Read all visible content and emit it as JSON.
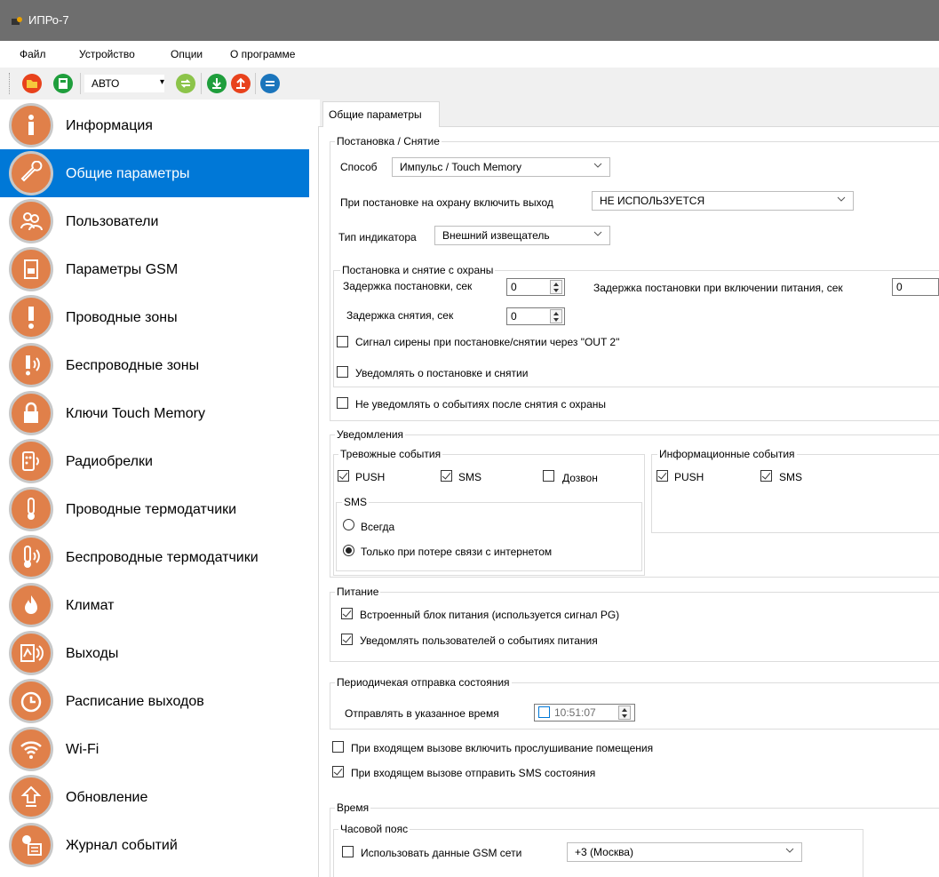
{
  "window": {
    "title": "ИПРо-7"
  },
  "menu": [
    "Файл",
    "Устройство",
    "Опции",
    "О программе"
  ],
  "toolbar": {
    "mode_value": "АВТО"
  },
  "sidebar": {
    "items": [
      {
        "label": "Информация",
        "icon": "info-icon"
      },
      {
        "label": "Общие параметры",
        "icon": "wrench-icon",
        "active": true
      },
      {
        "label": "Пользователи",
        "icon": "users-icon"
      },
      {
        "label": "Параметры GSM",
        "icon": "sim-card-icon"
      },
      {
        "label": "Проводные зоны",
        "icon": "exclamation-icon"
      },
      {
        "label": "Беспроводные зоны",
        "icon": "wireless-exclamation-icon"
      },
      {
        "label": "Ключи Touch Memory",
        "icon": "lock-icon"
      },
      {
        "label": "Радиобрелки",
        "icon": "keyfob-icon"
      },
      {
        "label": "Проводные термодатчики",
        "icon": "thermometer-icon"
      },
      {
        "label": "Беспроводные термодатчики",
        "icon": "wireless-thermometer-icon"
      },
      {
        "label": "Климат",
        "icon": "flame-icon"
      },
      {
        "label": "Выходы",
        "icon": "relay-icon"
      },
      {
        "label": "Расписание выходов",
        "icon": "clock-icon"
      },
      {
        "label": "Wi-Fi",
        "icon": "wifi-icon"
      },
      {
        "label": "Обновление",
        "icon": "upload-arrow-icon"
      },
      {
        "label": "Журнал событий",
        "icon": "log-icon"
      }
    ]
  },
  "main": {
    "tab": "Общие параметры",
    "arming": {
      "title": "Постановка / Снятие",
      "method_label": "Способ",
      "method_value": "Импульс / Touch Memory",
      "output_label": "При постановке на охрану включить выход",
      "output_value": "НЕ ИСПОЛЬЗУЕТСЯ",
      "indicator_label": "Тип индикатора",
      "indicator_value": "Внешний извещатель",
      "sub": {
        "title": "Постановка и снятие с охраны",
        "arm_delay_label": "Задержка постановки, сек",
        "arm_delay_value": "0",
        "power_delay_label": "Задержка постановки при включении питания, сек",
        "power_delay_value": "0",
        "disarm_delay_label": "Задержка снятия, сек",
        "disarm_delay_value": "0",
        "siren_label": "Сигнал сирены при постановке/снятии через \"OUT 2\"",
        "siren_checked": false,
        "notify_label": "Уведомлять о постановке и снятии",
        "notify_checked": false
      },
      "no_notify_label": "Не уведомлять о событиях после снятия с охраны",
      "no_notify_checked": false
    },
    "notifications": {
      "title": "Уведомления",
      "alarm_title": "Тревожные события",
      "alarm_push": "PUSH",
      "alarm_sms": "SMS",
      "alarm_call": "Дозвон",
      "sms_title": "SMS",
      "sms_always": "Всегда",
      "sms_only_lost": "Только при потере связи с интернетом",
      "info_title": "Информационные события",
      "info_push": "PUSH",
      "info_sms": "SMS"
    },
    "power": {
      "title": "Питание",
      "builtin_label": "Встроенный блок питания (используется сигнал PG)",
      "notify_label": "Уведомлять пользователей о событиях питания"
    },
    "periodic": {
      "title": "Периодичекая отправка состояния",
      "send_label": "Отправлять в указанное время",
      "time_value": "10:51:07"
    },
    "listen_label": "При входящем вызове включить прослушивание помещения",
    "sms_state_label": "При входящем вызове отправить SMS состояния",
    "time": {
      "title": "Время",
      "tz_title": "Часовой пояс",
      "gsm_label": "Использовать данные GSM сети",
      "tz_value": "+3 (Москва)"
    }
  },
  "colors": {
    "accent": "#0078d7",
    "icon_orange": "#e0804a",
    "titlebar": "#6e6e6e"
  }
}
